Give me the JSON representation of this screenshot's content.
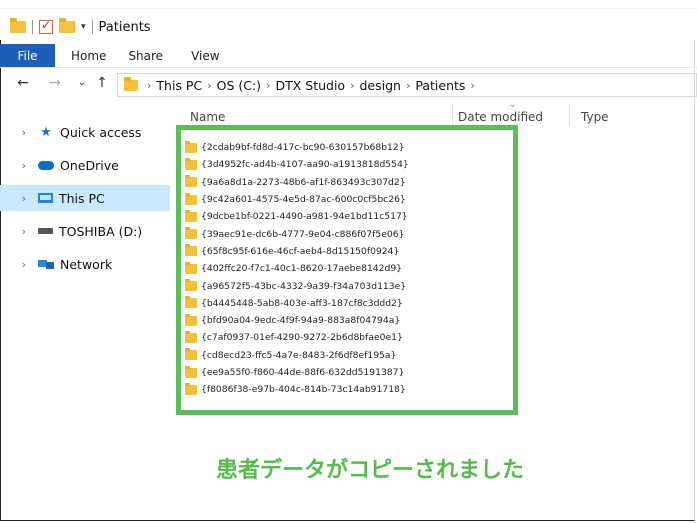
{
  "window": {
    "title": "Patients"
  },
  "ribbon": {
    "tabs": [
      "File",
      "Home",
      "Share",
      "View"
    ]
  },
  "nav": {
    "back_icon": "back-arrow-icon",
    "forward_icon": "forward-arrow-icon",
    "recent_icon": "chevron-down-icon",
    "up_icon": "up-arrow-icon"
  },
  "address": {
    "crumbs": [
      "This PC",
      "OS (C:)",
      "DTX Studio",
      "design",
      "Patients"
    ]
  },
  "sidebar": {
    "items": [
      {
        "label": "Quick access",
        "icon": "star-icon"
      },
      {
        "label": "OneDrive",
        "icon": "cloud-icon"
      },
      {
        "label": "This PC",
        "icon": "computer-icon",
        "selected": true
      },
      {
        "label": "TOSHIBA (D:)",
        "icon": "drive-icon"
      },
      {
        "label": "Network",
        "icon": "network-icon"
      }
    ]
  },
  "columns": {
    "name": "Name",
    "date": "Date modified",
    "type": "Type"
  },
  "files": [
    "{2cdab9bf-fd8d-417c-bc90-630157b68b12}",
    "{3d4952fc-ad4b-4107-aa90-a1913818d554}",
    "{9a6a8d1a-2273-48b6-af1f-863493c307d2}",
    "{9c42a601-4575-4e5d-87ac-600c0cf5bc26}",
    "{9dcbe1bf-0221-4490-a981-94e1bd11c517}",
    "{39aec91e-dc6b-4777-9e04-c886f07f5e06}",
    "{65f8c95f-616e-46cf-aeb4-8d15150f0924}",
    "{402ffc20-f7c1-40c1-8620-17aebe8142d9}",
    "{a96572f5-43bc-4332-9a39-f34a703d113e}",
    "{b4445448-5ab8-403e-aff3-187cf8c3ddd2}",
    "{bfd90a04-9edc-4f9f-94a9-883a8f04794a}",
    "{c7af0937-01ef-4290-9272-2b6d8bfae0e1}",
    "{cd8ecd23-ffc5-4a7e-8483-2f6df8ef195a}",
    "{ee9a55f0-f860-44de-88f6-632dd5191387}",
    "{f8086f38-e97b-404c-814b-73c14ab91718}"
  ],
  "caption": "患者データがコピーされました",
  "colors": {
    "highlight_border": "#5cbd5a",
    "caption": "#58b94e",
    "file_tab": "#1d5fb8",
    "selected_nav": "#cce8ff",
    "folder": "#f4c13f"
  }
}
